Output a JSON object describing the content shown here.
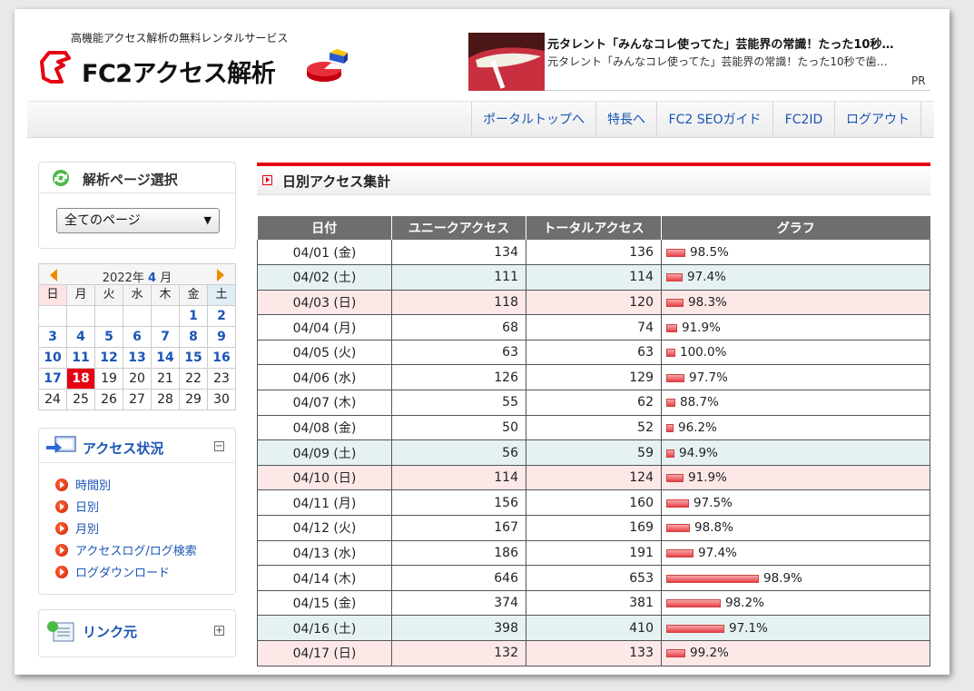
{
  "header": {
    "subtitle": "高機能アクセス解析の無料レンタルサービス",
    "title": "FC2アクセス解析"
  },
  "ad": {
    "title": "元タレント「みんなコレ使ってた」芸能界の常識！たった10秒…",
    "desc": "元タレント「みんなコレ使ってた」芸能界の常識！たった10秒で歯…",
    "pr": "PR"
  },
  "nav": [
    "ポータルトップへ",
    "特長へ",
    "FC2 SEOガイド",
    "FC2ID",
    "ログアウト"
  ],
  "page_select": {
    "title": "解析ページ選択",
    "selected": "全てのページ"
  },
  "calendar": {
    "month_label_pre": "2022年",
    "month_num": "4",
    "month_label_post": "月",
    "dow": [
      "日",
      "月",
      "火",
      "水",
      "木",
      "金",
      "土"
    ],
    "weeks": [
      [
        "",
        "",
        "",
        "",
        "",
        "1",
        "2"
      ],
      [
        "3",
        "4",
        "5",
        "6",
        "7",
        "8",
        "9"
      ],
      [
        "10",
        "11",
        "12",
        "13",
        "14",
        "15",
        "16"
      ],
      [
        "17",
        "18",
        "19",
        "20",
        "21",
        "22",
        "23"
      ],
      [
        "24",
        "25",
        "26",
        "27",
        "28",
        "29",
        "30"
      ]
    ],
    "today": "18",
    "linked_max": 17
  },
  "access_status": {
    "title": "アクセス状況",
    "toggle": "−",
    "items": [
      "時間別",
      "日別",
      "月別",
      "アクセスログ/ログ検索",
      "ログダウンロード"
    ]
  },
  "link_source": {
    "title": "リンク元",
    "toggle": "+"
  },
  "main": {
    "title": "日別アクセス集計",
    "columns": [
      "日付",
      "ユニークアクセス",
      "トータルアクセス",
      "グラフ"
    ],
    "rows": [
      {
        "date": "04/01 (金)",
        "unique": "134",
        "total": "136",
        "pct": "98.5%",
        "day": "weekday"
      },
      {
        "date": "04/02 (土)",
        "unique": "111",
        "total": "114",
        "pct": "97.4%",
        "day": "sat"
      },
      {
        "date": "04/03 (日)",
        "unique": "118",
        "total": "120",
        "pct": "98.3%",
        "day": "sun"
      },
      {
        "date": "04/04 (月)",
        "unique": "68",
        "total": "74",
        "pct": "91.9%",
        "day": "weekday"
      },
      {
        "date": "04/05 (火)",
        "unique": "63",
        "total": "63",
        "pct": "100.0%",
        "day": "weekday"
      },
      {
        "date": "04/06 (水)",
        "unique": "126",
        "total": "129",
        "pct": "97.7%",
        "day": "weekday"
      },
      {
        "date": "04/07 (木)",
        "unique": "55",
        "total": "62",
        "pct": "88.7%",
        "day": "weekday"
      },
      {
        "date": "04/08 (金)",
        "unique": "50",
        "total": "52",
        "pct": "96.2%",
        "day": "weekday"
      },
      {
        "date": "04/09 (土)",
        "unique": "56",
        "total": "59",
        "pct": "94.9%",
        "day": "sat"
      },
      {
        "date": "04/10 (日)",
        "unique": "114",
        "total": "124",
        "pct": "91.9%",
        "day": "sun"
      },
      {
        "date": "04/11 (月)",
        "unique": "156",
        "total": "160",
        "pct": "97.5%",
        "day": "weekday"
      },
      {
        "date": "04/12 (火)",
        "unique": "167",
        "total": "169",
        "pct": "98.8%",
        "day": "weekday"
      },
      {
        "date": "04/13 (水)",
        "unique": "186",
        "total": "191",
        "pct": "97.4%",
        "day": "weekday"
      },
      {
        "date": "04/14 (木)",
        "unique": "646",
        "total": "653",
        "pct": "98.9%",
        "day": "weekday"
      },
      {
        "date": "04/15 (金)",
        "unique": "374",
        "total": "381",
        "pct": "98.2%",
        "day": "weekday"
      },
      {
        "date": "04/16 (土)",
        "unique": "398",
        "total": "410",
        "pct": "97.1%",
        "day": "sat"
      },
      {
        "date": "04/17 (日)",
        "unique": "132",
        "total": "133",
        "pct": "99.2%",
        "day": "sun"
      }
    ]
  },
  "colors": {
    "accent": "#e60012",
    "link": "#1a55b5"
  }
}
